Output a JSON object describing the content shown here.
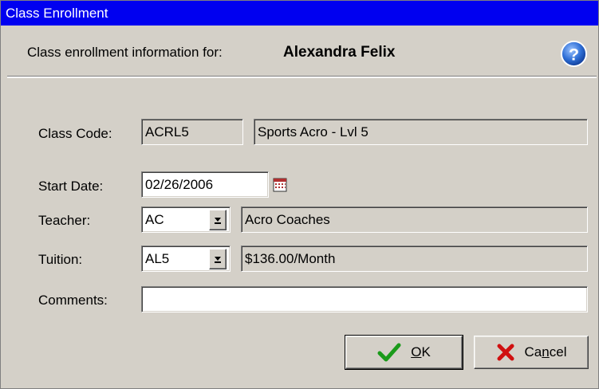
{
  "window": {
    "title": "Class Enrollment"
  },
  "header": {
    "label": "Class enrollment information for:",
    "student_name": "Alexandra Felix"
  },
  "fields": {
    "class_code": {
      "label": "Class Code:",
      "code": "ACRL5",
      "description": "Sports Acro - Lvl 5"
    },
    "start_date": {
      "label": "Start Date:",
      "value": "02/26/2006"
    },
    "teacher": {
      "label": "Teacher:",
      "code": "AC",
      "description": "Acro Coaches"
    },
    "tuition": {
      "label": "Tuition:",
      "code": "AL5",
      "description": "$136.00/Month"
    },
    "comments": {
      "label": "Comments:",
      "value": ""
    }
  },
  "buttons": {
    "ok": {
      "pre": "",
      "mnemonic": "O",
      "post": "K"
    },
    "cancel": {
      "pre": "Ca",
      "mnemonic": "n",
      "post": "cel"
    }
  },
  "colors": {
    "titlebar": "#0000f0",
    "dialog_bg": "#d4d0c8",
    "ok_check": "#1a9a1a",
    "cancel_x": "#d01010",
    "help": "#2f6fd6"
  },
  "icons": {
    "help": "help-icon",
    "calendar": "calendar-icon",
    "ok": "checkmark-icon",
    "cancel": "x-icon"
  }
}
